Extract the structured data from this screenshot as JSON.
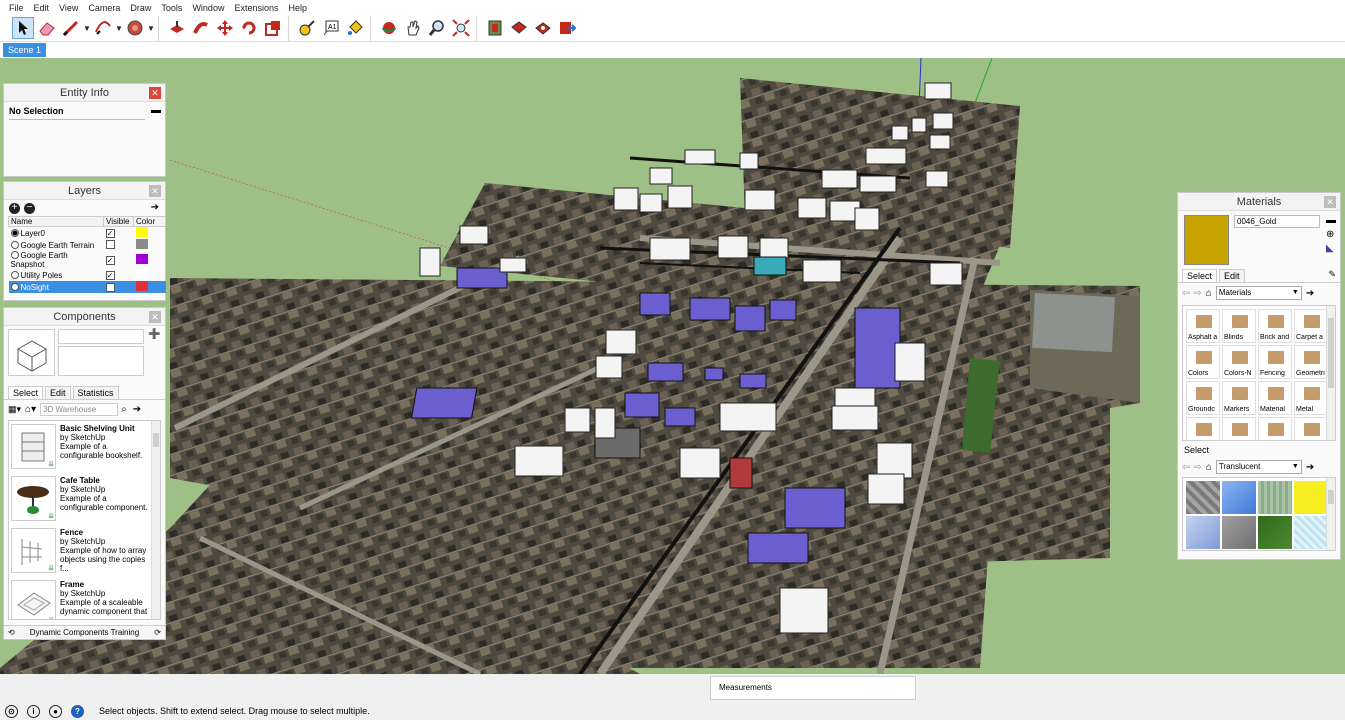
{
  "menu": [
    "File",
    "Edit",
    "View",
    "Camera",
    "Draw",
    "Tools",
    "Window",
    "Extensions",
    "Help"
  ],
  "toolbar_icons": [
    "select-tool",
    "eraser-tool",
    "line-tool",
    "arc-tool",
    "shape-tool",
    "push-pull-tool",
    "follow-me-tool",
    "move-tool",
    "rotate-tool",
    "scale-tool",
    "tape-measure-tool",
    "text-tool",
    "paint-bucket-tool",
    "orbit-tool",
    "pan-tool",
    "zoom-tool",
    "zoom-extents-tool",
    "warehouse-tool",
    "extension-warehouse-tool",
    "layout-tool",
    "send-to-layout-tool"
  ],
  "scene": {
    "tab": "Scene 1"
  },
  "entity_info": {
    "title": "Entity Info",
    "selection": "No Selection"
  },
  "layers": {
    "title": "Layers",
    "columns": {
      "name": "Name",
      "visible": "Visible",
      "color": "Color"
    },
    "rows": [
      {
        "name": "Layer0",
        "active": true,
        "visible": true,
        "color": "#ffff00"
      },
      {
        "name": "Google Earth Terrain",
        "active": false,
        "visible": false,
        "color": "#8a8a8a"
      },
      {
        "name": "Google Earth Snapshot",
        "active": false,
        "visible": true,
        "color": "#a000d6"
      },
      {
        "name": "Utility Poles",
        "active": false,
        "visible": true,
        "color": "#ffffff"
      },
      {
        "name": "NoSight",
        "active": false,
        "visible": true,
        "color": "#e0303c",
        "selected": true
      }
    ]
  },
  "components": {
    "title": "Components",
    "tabs": [
      "Select",
      "Edit",
      "Statistics"
    ],
    "search_placeholder": "3D Warehouse",
    "items": [
      {
        "name": "Basic Shelving Unit",
        "author": "by SketchUp",
        "desc": "Example of a configurable bookshelf."
      },
      {
        "name": "Cafe Table",
        "author": "by SketchUp",
        "desc": "Example of a configurable component."
      },
      {
        "name": "Fence",
        "author": "by SketchUp",
        "desc": "Example of how to array objects using the copies f..."
      },
      {
        "name": "Frame",
        "author": "by SketchUp",
        "desc": "Example of a scaleable dynamic component that ..."
      }
    ],
    "footer": "Dynamic Components Training"
  },
  "materials": {
    "title": "Materials",
    "current_name": "0046_Gold",
    "current_color": "#c7a302",
    "tabs": [
      "Select",
      "Edit"
    ],
    "library": "Materials",
    "folders": [
      "Asphalt a",
      "Blinds",
      "Brick and",
      "Carpet a",
      "Colors",
      "Colors-N",
      "Fencing",
      "Geometri",
      "Groundc",
      "Markers",
      "Material",
      "Metal",
      "",
      "",
      "",
      ""
    ],
    "select_label": "Select",
    "second_library": "Translucent",
    "translucent_colors": [
      "#8c8c8c",
      "#5a8fe6",
      "#a9c3a6",
      "#f7ef22",
      "#a0b6e6",
      "#8a8a8a",
      "#2f6a1e",
      "#bfe3f0",
      "#8fa9d8"
    ]
  },
  "status": {
    "measurements_label": "Measurements",
    "hint": "Select objects. Shift to extend select. Drag mouse to select multiple."
  }
}
